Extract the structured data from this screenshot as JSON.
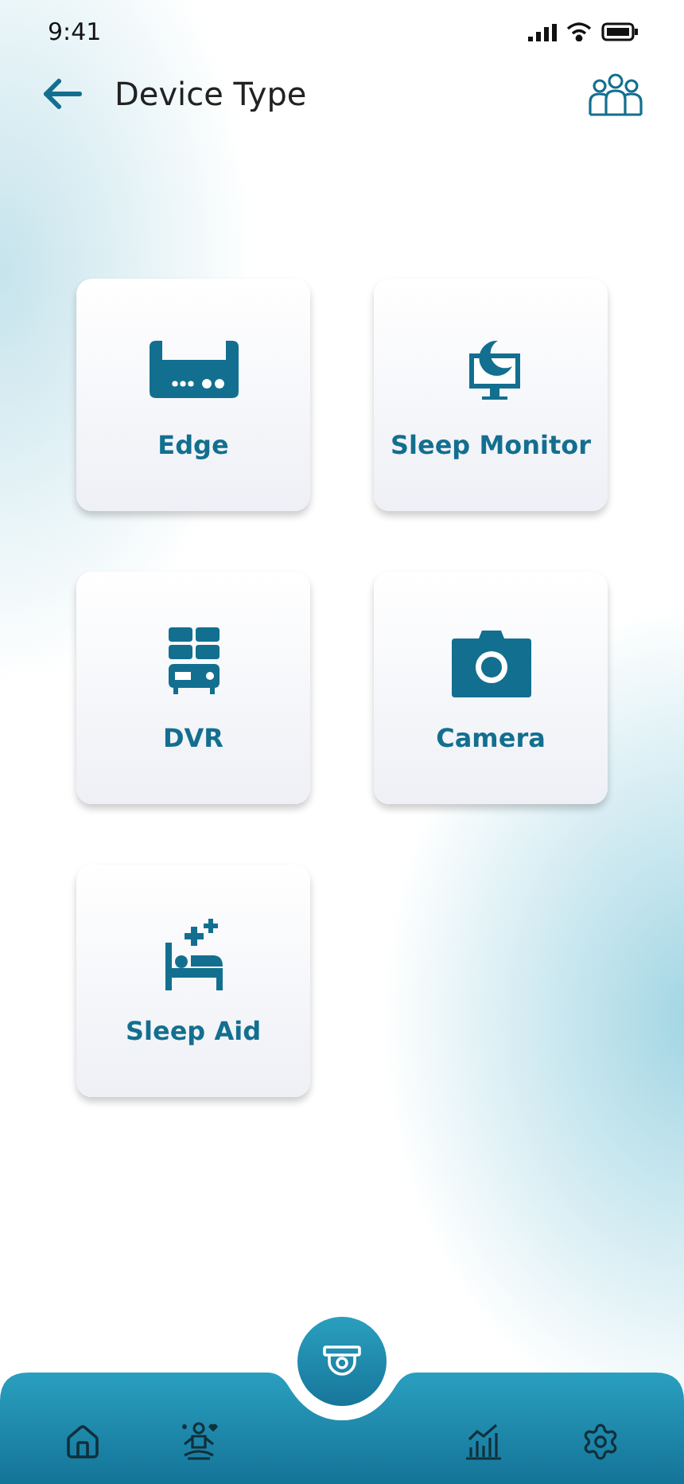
{
  "status_bar": {
    "time": "9:41"
  },
  "header": {
    "title": "Device Type"
  },
  "devices": [
    {
      "label": "Edge",
      "kind": "router"
    },
    {
      "label": "Sleep Monitor",
      "kind": "monitor"
    },
    {
      "label": "DVR",
      "kind": "dvr"
    },
    {
      "label": "Camera",
      "kind": "camera"
    },
    {
      "label": "Sleep Aid",
      "kind": "bed"
    }
  ],
  "nav": [
    {
      "kind": "home"
    },
    {
      "kind": "wellness"
    },
    {
      "kind": "camera"
    },
    {
      "kind": "chart"
    },
    {
      "kind": "settings"
    }
  ]
}
